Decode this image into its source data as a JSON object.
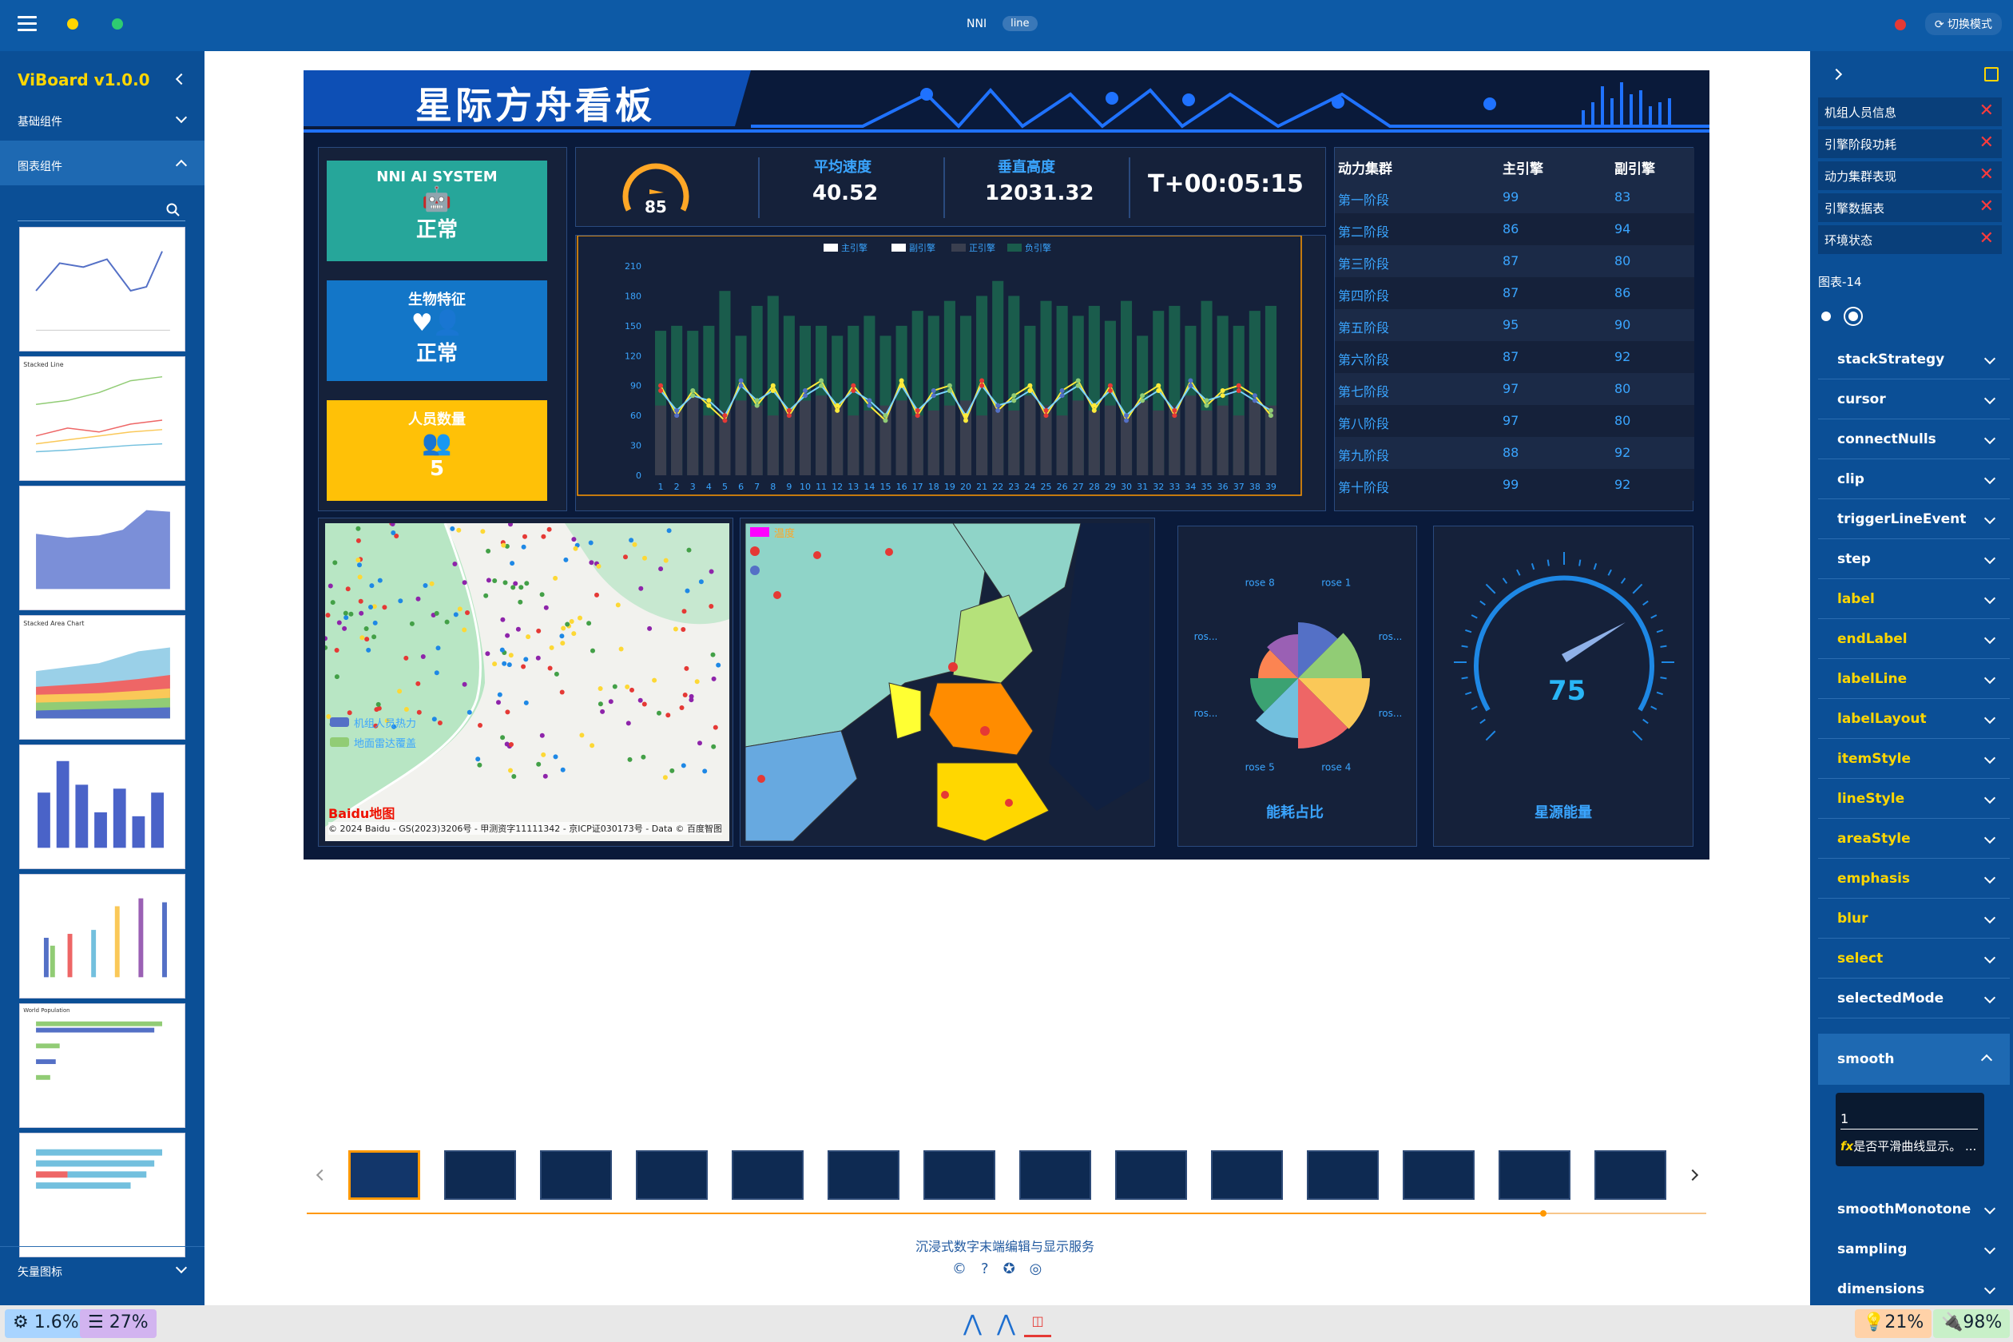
{
  "topbar": {
    "app": "NNI",
    "mode_pill": "line",
    "switch_label": "切换模式"
  },
  "leftbar": {
    "brand": "ViBoard v1.0.0",
    "nav": [
      {
        "label": "基础组件"
      },
      {
        "label": "图表组件"
      }
    ],
    "bottom_nav": "矢量图标",
    "thumb_titles": [
      "",
      "Stacked Line",
      "",
      "Stacked Area Chart",
      "",
      "",
      "World Population",
      ""
    ]
  },
  "dashboard": {
    "title": "星际方舟看板",
    "kpi": [
      {
        "title": "NNI AI SYSTEM",
        "value": "正常",
        "color": "#26a69a",
        "icon": "robot-icon"
      },
      {
        "title": "生物特征",
        "value": "正常",
        "color": "#1376c8",
        "icon": "user-heart-icon"
      },
      {
        "title": "人员数量",
        "value": "5",
        "color": "#ffc107",
        "icon": "users-icon"
      }
    ],
    "gauge_small": "85",
    "stats": [
      {
        "label": "平均速度",
        "value": "40.52"
      },
      {
        "label": "垂直高度",
        "value": "12031.32"
      }
    ],
    "timer": "T+00:05:15",
    "table": {
      "headers": [
        "动力集群",
        "主引擎",
        "副引擎"
      ],
      "rows": [
        [
          "第一阶段",
          "99",
          "83"
        ],
        [
          "第二阶段",
          "86",
          "94"
        ],
        [
          "第三阶段",
          "87",
          "80"
        ],
        [
          "第四阶段",
          "87",
          "86"
        ],
        [
          "第五阶段",
          "95",
          "90"
        ],
        [
          "第六阶段",
          "87",
          "92"
        ],
        [
          "第七阶段",
          "97",
          "80"
        ],
        [
          "第八阶段",
          "97",
          "80"
        ],
        [
          "第九阶段",
          "88",
          "92"
        ],
        [
          "第十阶段",
          "99",
          "92"
        ]
      ]
    },
    "map1": {
      "legend": [
        "机组人员热力",
        "地面雷达覆盖"
      ],
      "attribution": "© 2024 Baidu - GS(2023)3206号 - 甲测资字11111342 - 京ICP证030173号 - Data © 百度智图",
      "logo": "Baidu地图"
    },
    "map2": {
      "legend": [
        "温度",
        "",
        ""
      ]
    },
    "pie": {
      "title": "能耗占比",
      "labels": [
        "rose 1",
        "ros...",
        "ros...",
        "rose 4",
        "rose 5",
        "ros...",
        "ros...",
        "rose 8"
      ]
    },
    "gauge_big": {
      "title": "星源能量",
      "value": "75"
    }
  },
  "chart_data": {
    "type": "bar",
    "legend": [
      "主引擎",
      "副引擎",
      "正引擎",
      "负引擎"
    ],
    "x": [
      "1",
      "2",
      "3",
      "4",
      "5",
      "6",
      "7",
      "8",
      "9",
      "10",
      "11",
      "12",
      "13",
      "14",
      "15",
      "16",
      "17",
      "18",
      "19",
      "20",
      "21",
      "22",
      "23",
      "24",
      "25",
      "26",
      "27",
      "28",
      "29",
      "30",
      "31",
      "32",
      "33",
      "34",
      "35",
      "36",
      "37",
      "38",
      "39"
    ],
    "ylim": [
      0,
      210
    ],
    "yticks": [
      0,
      30,
      60,
      90,
      120,
      150,
      180,
      210
    ],
    "series": [
      {
        "name": "正引擎",
        "kind": "bar",
        "values": [
          145,
          150,
          145,
          150,
          185,
          140,
          170,
          180,
          160,
          150,
          150,
          140,
          150,
          160,
          140,
          150,
          165,
          160,
          175,
          160,
          180,
          195,
          180,
          150,
          175,
          170,
          160,
          170,
          155,
          175,
          140,
          165,
          170,
          150,
          175,
          160,
          150,
          165,
          170
        ]
      },
      {
        "name": "负引擎",
        "kind": "bar",
        "values": [
          70,
          65,
          80,
          60,
          65,
          75,
          70,
          60,
          65,
          75,
          80,
          70,
          60,
          65,
          70,
          75,
          60,
          65,
          70,
          75,
          60,
          70,
          65,
          80,
          70,
          60,
          75,
          65,
          70,
          60,
          75,
          65,
          70,
          80,
          65,
          70,
          60,
          75,
          70
        ]
      },
      {
        "name": "主引擎",
        "kind": "line",
        "values": [
          90,
          60,
          85,
          70,
          55,
          95,
          70,
          90,
          60,
          85,
          95,
          65,
          90,
          70,
          55,
          95,
          60,
          85,
          90,
          55,
          95,
          65,
          80,
          90,
          60,
          85,
          95,
          65,
          90,
          55,
          80,
          90,
          60,
          95,
          70,
          85,
          90,
          80,
          60
        ]
      },
      {
        "name": "副引擎",
        "kind": "line",
        "values": [
          85,
          65,
          80,
          75,
          60,
          90,
          75,
          85,
          65,
          80,
          90,
          70,
          85,
          75,
          60,
          90,
          65,
          80,
          85,
          60,
          90,
          70,
          75,
          85,
          65,
          80,
          90,
          70,
          85,
          60,
          75,
          85,
          65,
          90,
          75,
          80,
          85,
          75,
          65
        ]
      }
    ]
  },
  "carousel": {
    "count": 14,
    "caption": "沉浸式数字末端编辑与显示服务"
  },
  "rightbar": {
    "tabs": [
      "机组人员信息",
      "引擎阶段功耗",
      "动力集群表现",
      "引擎数据表",
      "环境状态"
    ],
    "chart_name": "图表-14",
    "props": [
      "stackStrategy",
      "cursor",
      "connectNulls",
      "clip",
      "triggerLineEvent",
      "step",
      "label",
      "endLabel",
      "labelLine",
      "labelLayout",
      "itemStyle",
      "lineStyle",
      "areaStyle",
      "emphasis",
      "blur",
      "select",
      "selectedMode"
    ],
    "yellow_props": [
      "label",
      "endLabel",
      "labelLine",
      "labelLayout",
      "itemStyle",
      "lineStyle",
      "areaStyle",
      "emphasis",
      "blur",
      "select"
    ],
    "smooth": {
      "label": "smooth",
      "value": "1",
      "desc": "是否平滑曲线显示。 ..."
    },
    "after": [
      "smoothMonotone",
      "sampling",
      "dimensions"
    ]
  },
  "statusbar": {
    "cpu": "1.6%",
    "mem": "27%",
    "bulb": "21%",
    "battery": "98%"
  }
}
